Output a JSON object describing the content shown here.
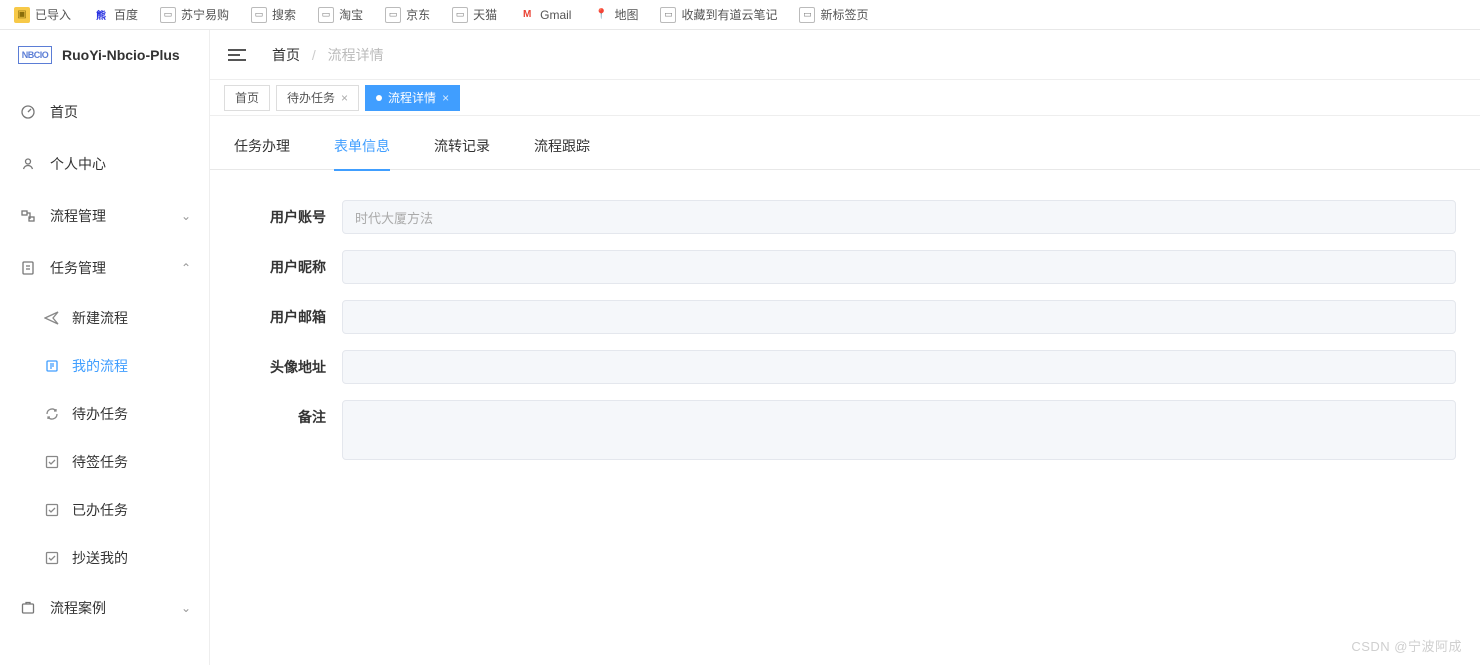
{
  "bookmarks": [
    {
      "label": "已导入",
      "kind": "folder"
    },
    {
      "label": "百度",
      "kind": "baidu"
    },
    {
      "label": "苏宁易购",
      "kind": "page"
    },
    {
      "label": "搜索",
      "kind": "page"
    },
    {
      "label": "淘宝",
      "kind": "page"
    },
    {
      "label": "京东",
      "kind": "page"
    },
    {
      "label": "天猫",
      "kind": "page"
    },
    {
      "label": "Gmail",
      "kind": "gmail"
    },
    {
      "label": "地图",
      "kind": "maps"
    },
    {
      "label": "收藏到有道云笔记",
      "kind": "page"
    },
    {
      "label": "新标签页",
      "kind": "page"
    }
  ],
  "brand": {
    "logo": "NBCIO",
    "title": "RuoYi-Nbcio-Plus"
  },
  "sidebar": {
    "items": [
      {
        "label": "首页",
        "icon": "dashboard",
        "expand": null
      },
      {
        "label": "个人中心",
        "icon": "user",
        "expand": null
      },
      {
        "label": "流程管理",
        "icon": "flow",
        "expand": "down"
      },
      {
        "label": "任务管理",
        "icon": "task",
        "expand": "up",
        "children": [
          {
            "label": "新建流程",
            "icon": "send"
          },
          {
            "label": "我的流程",
            "icon": "my",
            "active": true
          },
          {
            "label": "待办任务",
            "icon": "refresh"
          },
          {
            "label": "待签任务",
            "icon": "check"
          },
          {
            "label": "已办任务",
            "icon": "check"
          },
          {
            "label": "抄送我的",
            "icon": "check"
          }
        ]
      },
      {
        "label": "流程案例",
        "icon": "case",
        "expand": "down"
      }
    ]
  },
  "breadcrumb": {
    "home": "首页",
    "current": "流程详情"
  },
  "tabs": [
    {
      "label": "首页",
      "closable": false,
      "active": false
    },
    {
      "label": "待办任务",
      "closable": true,
      "active": false
    },
    {
      "label": "流程详情",
      "closable": true,
      "active": true
    }
  ],
  "inner_tabs": [
    {
      "label": "任务办理",
      "active": false
    },
    {
      "label": "表单信息",
      "active": true
    },
    {
      "label": "流转记录",
      "active": false
    },
    {
      "label": "流程跟踪",
      "active": false
    }
  ],
  "form": {
    "fields": [
      {
        "label": "用户账号",
        "value": "时代大厦方法",
        "placeholder": "",
        "type": "text"
      },
      {
        "label": "用户昵称",
        "value": "",
        "placeholder": "",
        "type": "text"
      },
      {
        "label": "用户邮箱",
        "value": "",
        "placeholder": "",
        "type": "text"
      },
      {
        "label": "头像地址",
        "value": "",
        "placeholder": "",
        "type": "text"
      },
      {
        "label": "备注",
        "value": "",
        "placeholder": "",
        "type": "textarea"
      }
    ]
  },
  "watermark": "CSDN @宁波阿成"
}
